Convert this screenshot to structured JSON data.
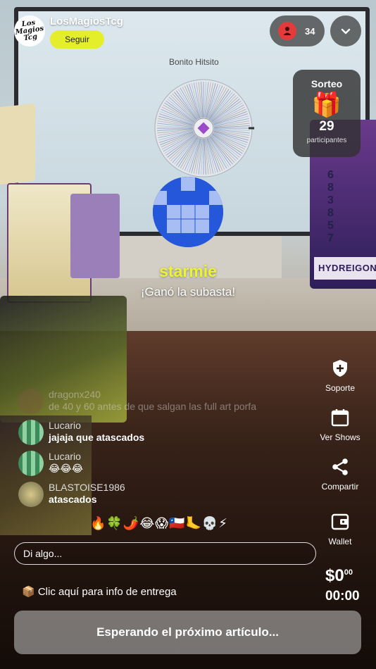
{
  "header": {
    "host_logo_text": "Los Magios Tcg",
    "host_name": "LosMagiosTcg",
    "follow_label": "Seguir",
    "viewer_count": "34"
  },
  "giveaway": {
    "title": "Sorteo",
    "gift_icon": "🎁",
    "count": "29",
    "label": "participantes"
  },
  "wheel": {
    "title": "Bonito Hitsito"
  },
  "winner": {
    "name": "starmie",
    "message": "¡Ganó la subasta!"
  },
  "background_labels": {
    "right_box_tag": "HYDREIGON",
    "right_box_numbers": "6 8 3 8 5 7"
  },
  "chat": {
    "messages": [
      {
        "user": "dragonx240",
        "text": "de 40 y 60 antes de que salgan las full art porfa",
        "avatar_color": "#7a5a3a"
      },
      {
        "user": "Lucario",
        "text": "jajaja que atascados",
        "avatar_color": "#4aa06a"
      },
      {
        "user": "Lucario",
        "text": "😂😂😂",
        "avatar_color": "#4aa06a"
      },
      {
        "user": "BLASTOISE1986",
        "text": "atascados",
        "avatar_color": "#c8b06a"
      }
    ]
  },
  "side_actions": [
    {
      "label": "Soporte",
      "icon": "shield-plus-icon"
    },
    {
      "label": "Ver Shows",
      "icon": "calendar-icon"
    },
    {
      "label": "Compartir",
      "icon": "share-icon"
    },
    {
      "label": "Wallet",
      "icon": "wallet-icon"
    }
  ],
  "reactions": "🔥🍀🌶️😂😱🇨🇱🦶💀⚡",
  "input": {
    "placeholder": "Di algo..."
  },
  "price": {
    "amount": "$0",
    "cents": "00"
  },
  "timer": "00:00",
  "delivery_info": "📦 Clic aquí para info de entrega",
  "cta_label": "Esperando el próximo artículo...",
  "colors": {
    "accent_yellow": "#e4ee2b",
    "winner_name": "#ecf331",
    "viewer_badge": "#e53a3a",
    "winner_avatar": "#2457d9"
  }
}
